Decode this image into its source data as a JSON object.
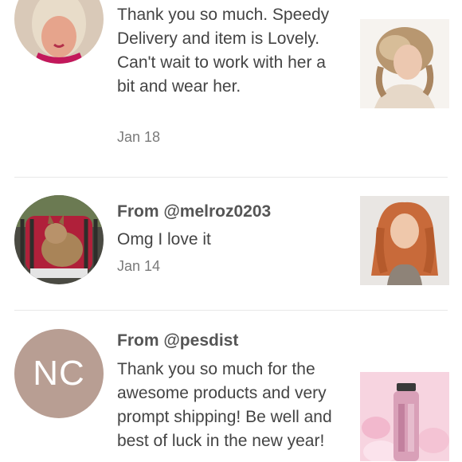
{
  "reviews": [
    {
      "from": "",
      "message": "Thank you so much. Speedy Delivery and item is Lovely. Can't wait to work with her a bit and wear her.",
      "date": "Jan 18"
    },
    {
      "from": "From @melroz0203",
      "message": "Omg I love it",
      "date": "Jan 14"
    },
    {
      "from": "From @pesdist",
      "initials": "NC",
      "message": "Thank you so much for the awesome products and very prompt shipping! Be well and best of luck in the new year!",
      "date": ""
    }
  ],
  "colors": {
    "initials_avatar_bg": "#b89e93",
    "divider": "#e8e8e8"
  }
}
